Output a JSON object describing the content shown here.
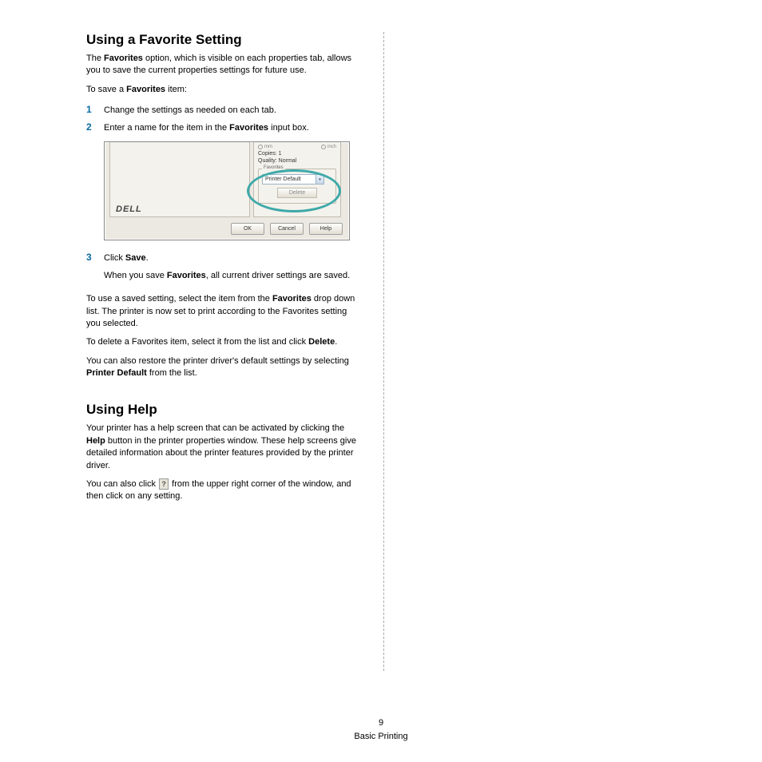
{
  "section1": {
    "heading": "Using a Favorite Setting",
    "p1_a": "The ",
    "p1_b": "Favorites",
    "p1_c": " option, which is visible on each properties tab, allows you to save the current properties settings for future use.",
    "p2_a": "To save a ",
    "p2_b": "Favorites",
    "p2_c": " item:",
    "steps": {
      "n1": "1",
      "s1": "Change the settings as needed on each tab.",
      "n2": "2",
      "s2_a": "Enter a name for the item in the ",
      "s2_b": "Favorites",
      "s2_c": " input box.",
      "n3": "3",
      "s3_a": "Click ",
      "s3_b": "Save",
      "s3_c": ".",
      "s3_sub_a": "When you save ",
      "s3_sub_b": "Favorites",
      "s3_sub_c": ", all current driver settings are saved."
    },
    "p3_a": "To use a saved setting, select the item from the ",
    "p3_b": "Favorites",
    "p3_c": " drop down list. The printer is now set to print according to the Favorites setting you selected.",
    "p4_a": "To delete a Favorites item, select it from the list and click ",
    "p4_b": "Delete",
    "p4_c": ".",
    "p5_a": "You can also restore the printer driver's default settings by selecting ",
    "p5_b": "Printer Default",
    "p5_c": " from the list."
  },
  "section2": {
    "heading": "Using Help",
    "p1_a": "Your printer has a help screen that can be activated by clicking the ",
    "p1_b": "Help",
    "p1_c": " button in the printer properties window. These help screens give detailed information about the printer features provided by the printer driver.",
    "p2_a": "You can also click ",
    "p2_b": " from the upper right corner of the window, and then click on any setting."
  },
  "shot": {
    "logo": "DELL",
    "radio1": "mm",
    "radio2": "inch",
    "copies_label": "Copies: 1",
    "quality_label": "Quality: Normal",
    "fav_legend": "Favorites",
    "fav_value": "Printer Default",
    "delete_btn": "Delete",
    "ok": "OK",
    "cancel": "Cancel",
    "help": "Help"
  },
  "qicon": "?",
  "footer": {
    "page": "9",
    "title": "Basic Printing"
  }
}
